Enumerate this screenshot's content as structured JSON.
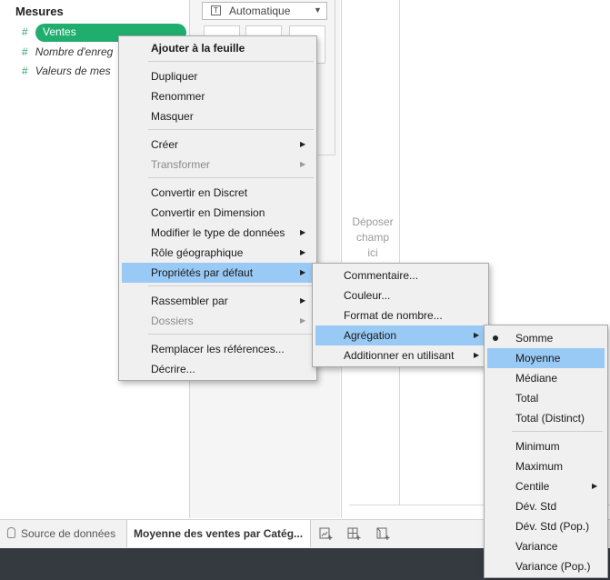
{
  "data_pane": {
    "header": "Mesures",
    "fields": [
      {
        "label": "Ventes"
      },
      {
        "label": "Nombre d'enreg"
      },
      {
        "label": "Valeurs de mes"
      }
    ]
  },
  "marks": {
    "type_select": "Automatique"
  },
  "canvas": {
    "drop_lines": [
      "Déposer",
      "champ",
      "ici"
    ]
  },
  "tabs": {
    "source": "Source de données",
    "sheet": "Moyenne des ventes par Catég..."
  },
  "context_menu": {
    "items": [
      {
        "label": "Ajouter à la feuille"
      },
      {
        "label": "Dupliquer"
      },
      {
        "label": "Renommer"
      },
      {
        "label": "Masquer"
      },
      {
        "label": "Créer"
      },
      {
        "label": "Transformer"
      },
      {
        "label": "Convertir en Discret"
      },
      {
        "label": "Convertir en Dimension"
      },
      {
        "label": "Modifier le type de données"
      },
      {
        "label": "Rôle géographique"
      },
      {
        "label": "Propriétés par défaut"
      },
      {
        "label": "Rassembler par"
      },
      {
        "label": "Dossiers"
      },
      {
        "label": "Remplacer les références..."
      },
      {
        "label": "Décrire..."
      }
    ]
  },
  "default_props_menu": {
    "items": [
      {
        "label": "Commentaire..."
      },
      {
        "label": "Couleur..."
      },
      {
        "label": "Format de nombre..."
      },
      {
        "label": "Agrégation"
      },
      {
        "label": "Additionner en utilisant"
      }
    ]
  },
  "aggregation_menu": {
    "selected": "Somme",
    "highlighted": "Moyenne",
    "items": [
      {
        "label": "Somme"
      },
      {
        "label": "Moyenne"
      },
      {
        "label": "Médiane"
      },
      {
        "label": "Total"
      },
      {
        "label": "Total (Distinct)"
      },
      {
        "label": "Minimum"
      },
      {
        "label": "Maximum"
      },
      {
        "label": "Centile"
      },
      {
        "label": "Dév. Std"
      },
      {
        "label": "Dév. Std (Pop.)"
      },
      {
        "label": "Variance"
      },
      {
        "label": "Variance (Pop.)"
      }
    ]
  },
  "colors": {
    "field_pill": "#1fae6e",
    "highlight": "#99c9f5",
    "footer": "#353a40"
  }
}
